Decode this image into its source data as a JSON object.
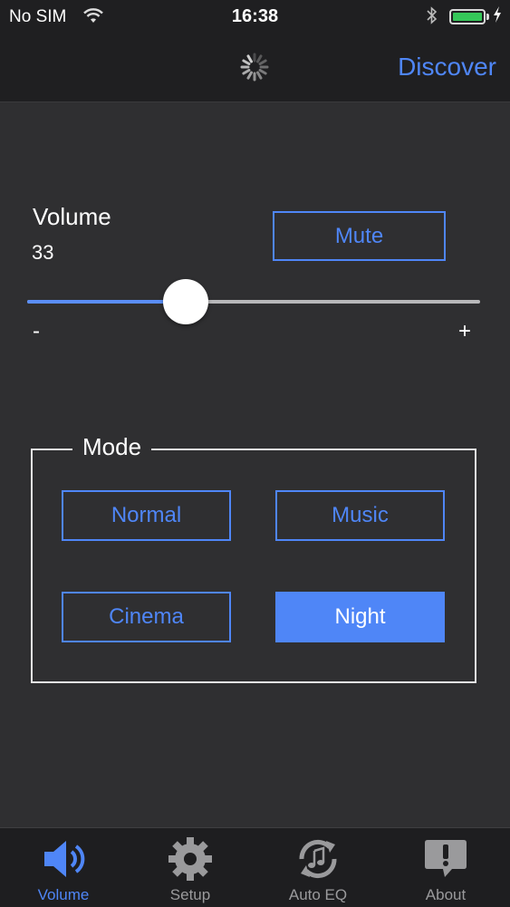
{
  "status_bar": {
    "carrier": "No SIM",
    "time": "16:38"
  },
  "nav": {
    "discover_label": "Discover"
  },
  "volume": {
    "label": "Volume",
    "value": "33",
    "level_fraction": 0.35,
    "mute_label": "Mute",
    "min_label": "-",
    "max_label": "+"
  },
  "mode": {
    "title": "Mode",
    "buttons": [
      {
        "label": "Normal",
        "active": false
      },
      {
        "label": "Music",
        "active": false
      },
      {
        "label": "Cinema",
        "active": false
      },
      {
        "label": "Night",
        "active": true
      }
    ]
  },
  "tabs": [
    {
      "label": "Volume",
      "icon": "speaker-icon",
      "active": true
    },
    {
      "label": "Setup",
      "icon": "gear-icon",
      "active": false
    },
    {
      "label": "Auto EQ",
      "icon": "auto-eq-icon",
      "active": false
    },
    {
      "label": "About",
      "icon": "about-icon",
      "active": false
    }
  ],
  "colors": {
    "accent": "#4f86f7",
    "background": "#2f2f31",
    "bar_background": "#1f1f21",
    "battery": "#35c759"
  }
}
